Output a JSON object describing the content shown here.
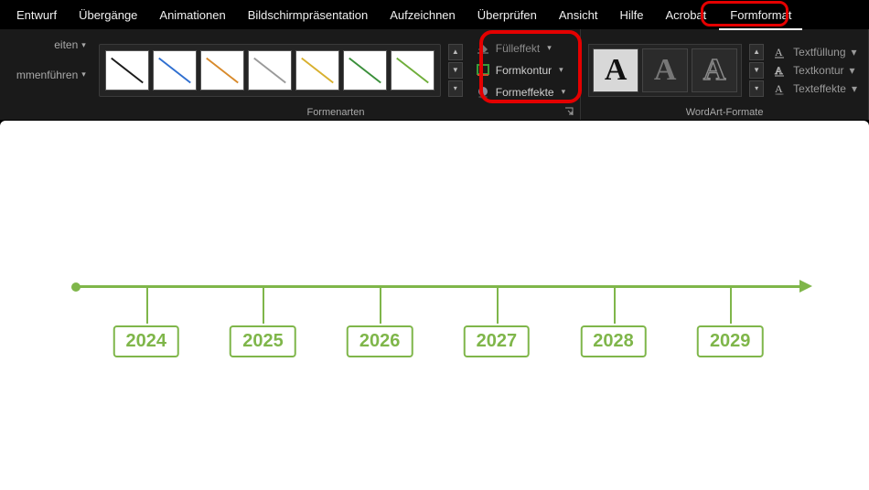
{
  "tabs": {
    "entwurf": "Entwurf",
    "uebergaenge": "Übergänge",
    "animationen": "Animationen",
    "bildschirm": "Bildschirmpräsentation",
    "aufzeichnen": "Aufzeichnen",
    "ueberpruefen": "Überprüfen",
    "ansicht": "Ansicht",
    "hilfe": "Hilfe",
    "acrobat": "Acrobat",
    "formformat": "Formformat"
  },
  "left_partial": {
    "top": "eiten",
    "bottom": "mmenführen"
  },
  "groups": {
    "formenarten": "Formenarten",
    "wordart": "WordArt-Formate"
  },
  "shape_menu": {
    "fuelleffekt": "Fülleffekt",
    "formkontur": "Formkontur",
    "formeffekte": "Formeffekte"
  },
  "text_menu": {
    "textfuellung": "Textfüllung",
    "textkontur": "Textkontur",
    "texteffekte": "Texteffekte"
  },
  "line_colors": [
    "#1b1b1b",
    "#2f6fd0",
    "#d88a2b",
    "#9a9a9a",
    "#d8b02e",
    "#3a8f3a",
    "#6fae3a"
  ],
  "timeline": {
    "years": [
      "2024",
      "2025",
      "2026",
      "2027",
      "2028",
      "2029"
    ]
  },
  "chart_data": {
    "type": "bar",
    "title": "",
    "xlabel": "",
    "ylabel": "",
    "categories": [
      "2024",
      "2025",
      "2026",
      "2027",
      "2028",
      "2029"
    ],
    "values": [
      0,
      0,
      0,
      0,
      0,
      0
    ],
    "note": "timeline with year markers only, no magnitudes"
  }
}
